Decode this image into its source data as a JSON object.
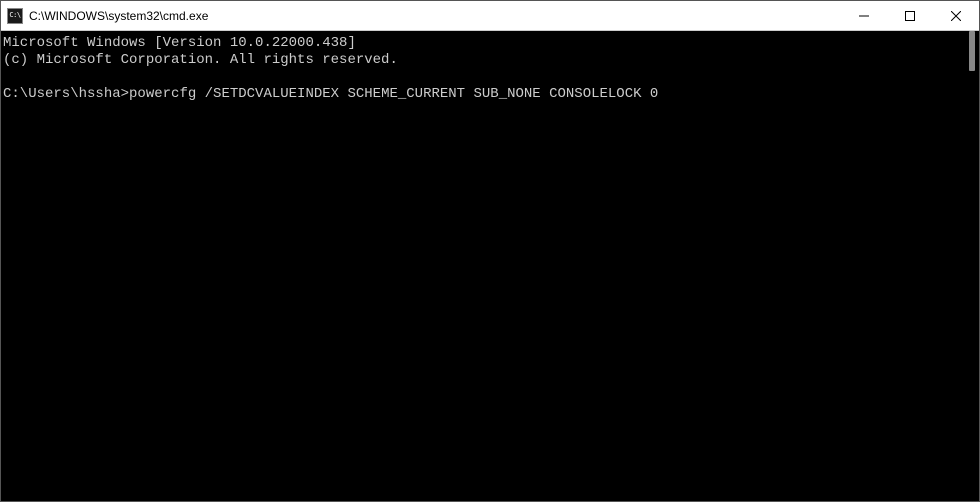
{
  "titlebar": {
    "icon_label": "C:\\",
    "title": "C:\\WINDOWS\\system32\\cmd.exe"
  },
  "terminal": {
    "line1": "Microsoft Windows [Version 10.0.22000.438]",
    "line2": "(c) Microsoft Corporation. All rights reserved.",
    "blank": "",
    "prompt": "C:\\Users\\hssha>",
    "command": "powercfg /SETDCVALUEINDEX SCHEME_CURRENT SUB_NONE CONSOLELOCK 0"
  }
}
